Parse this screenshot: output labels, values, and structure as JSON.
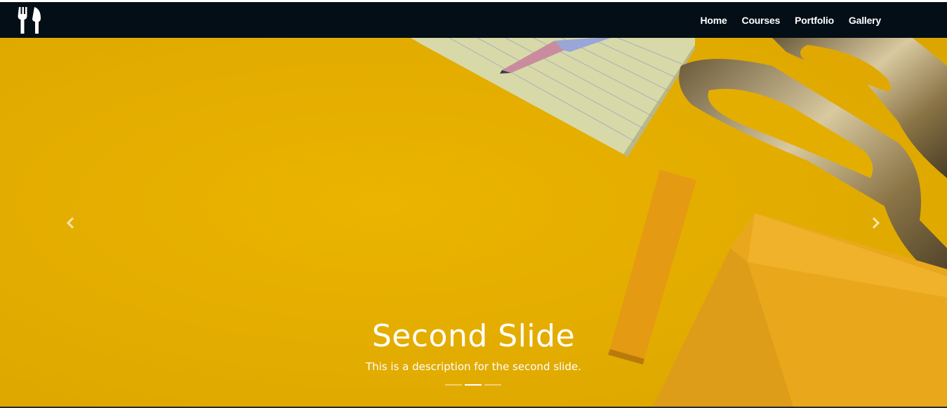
{
  "brand": {
    "icon": "fork-knife-icon"
  },
  "nav": {
    "items": [
      {
        "label": "Home"
      },
      {
        "label": "Courses"
      },
      {
        "label": "Portfolio"
      },
      {
        "label": "Gallery"
      }
    ]
  },
  "carousel": {
    "caption_title": "Second Slide",
    "caption_description": "This is a description for the second slide.",
    "prev_icon": "chevron-left-icon",
    "next_icon": "chevron-right-icon",
    "slide_count": 3,
    "active_index": 1,
    "background_color": "#e6b000"
  },
  "colors": {
    "navbar": "#030e16",
    "text": "#ffffff"
  }
}
